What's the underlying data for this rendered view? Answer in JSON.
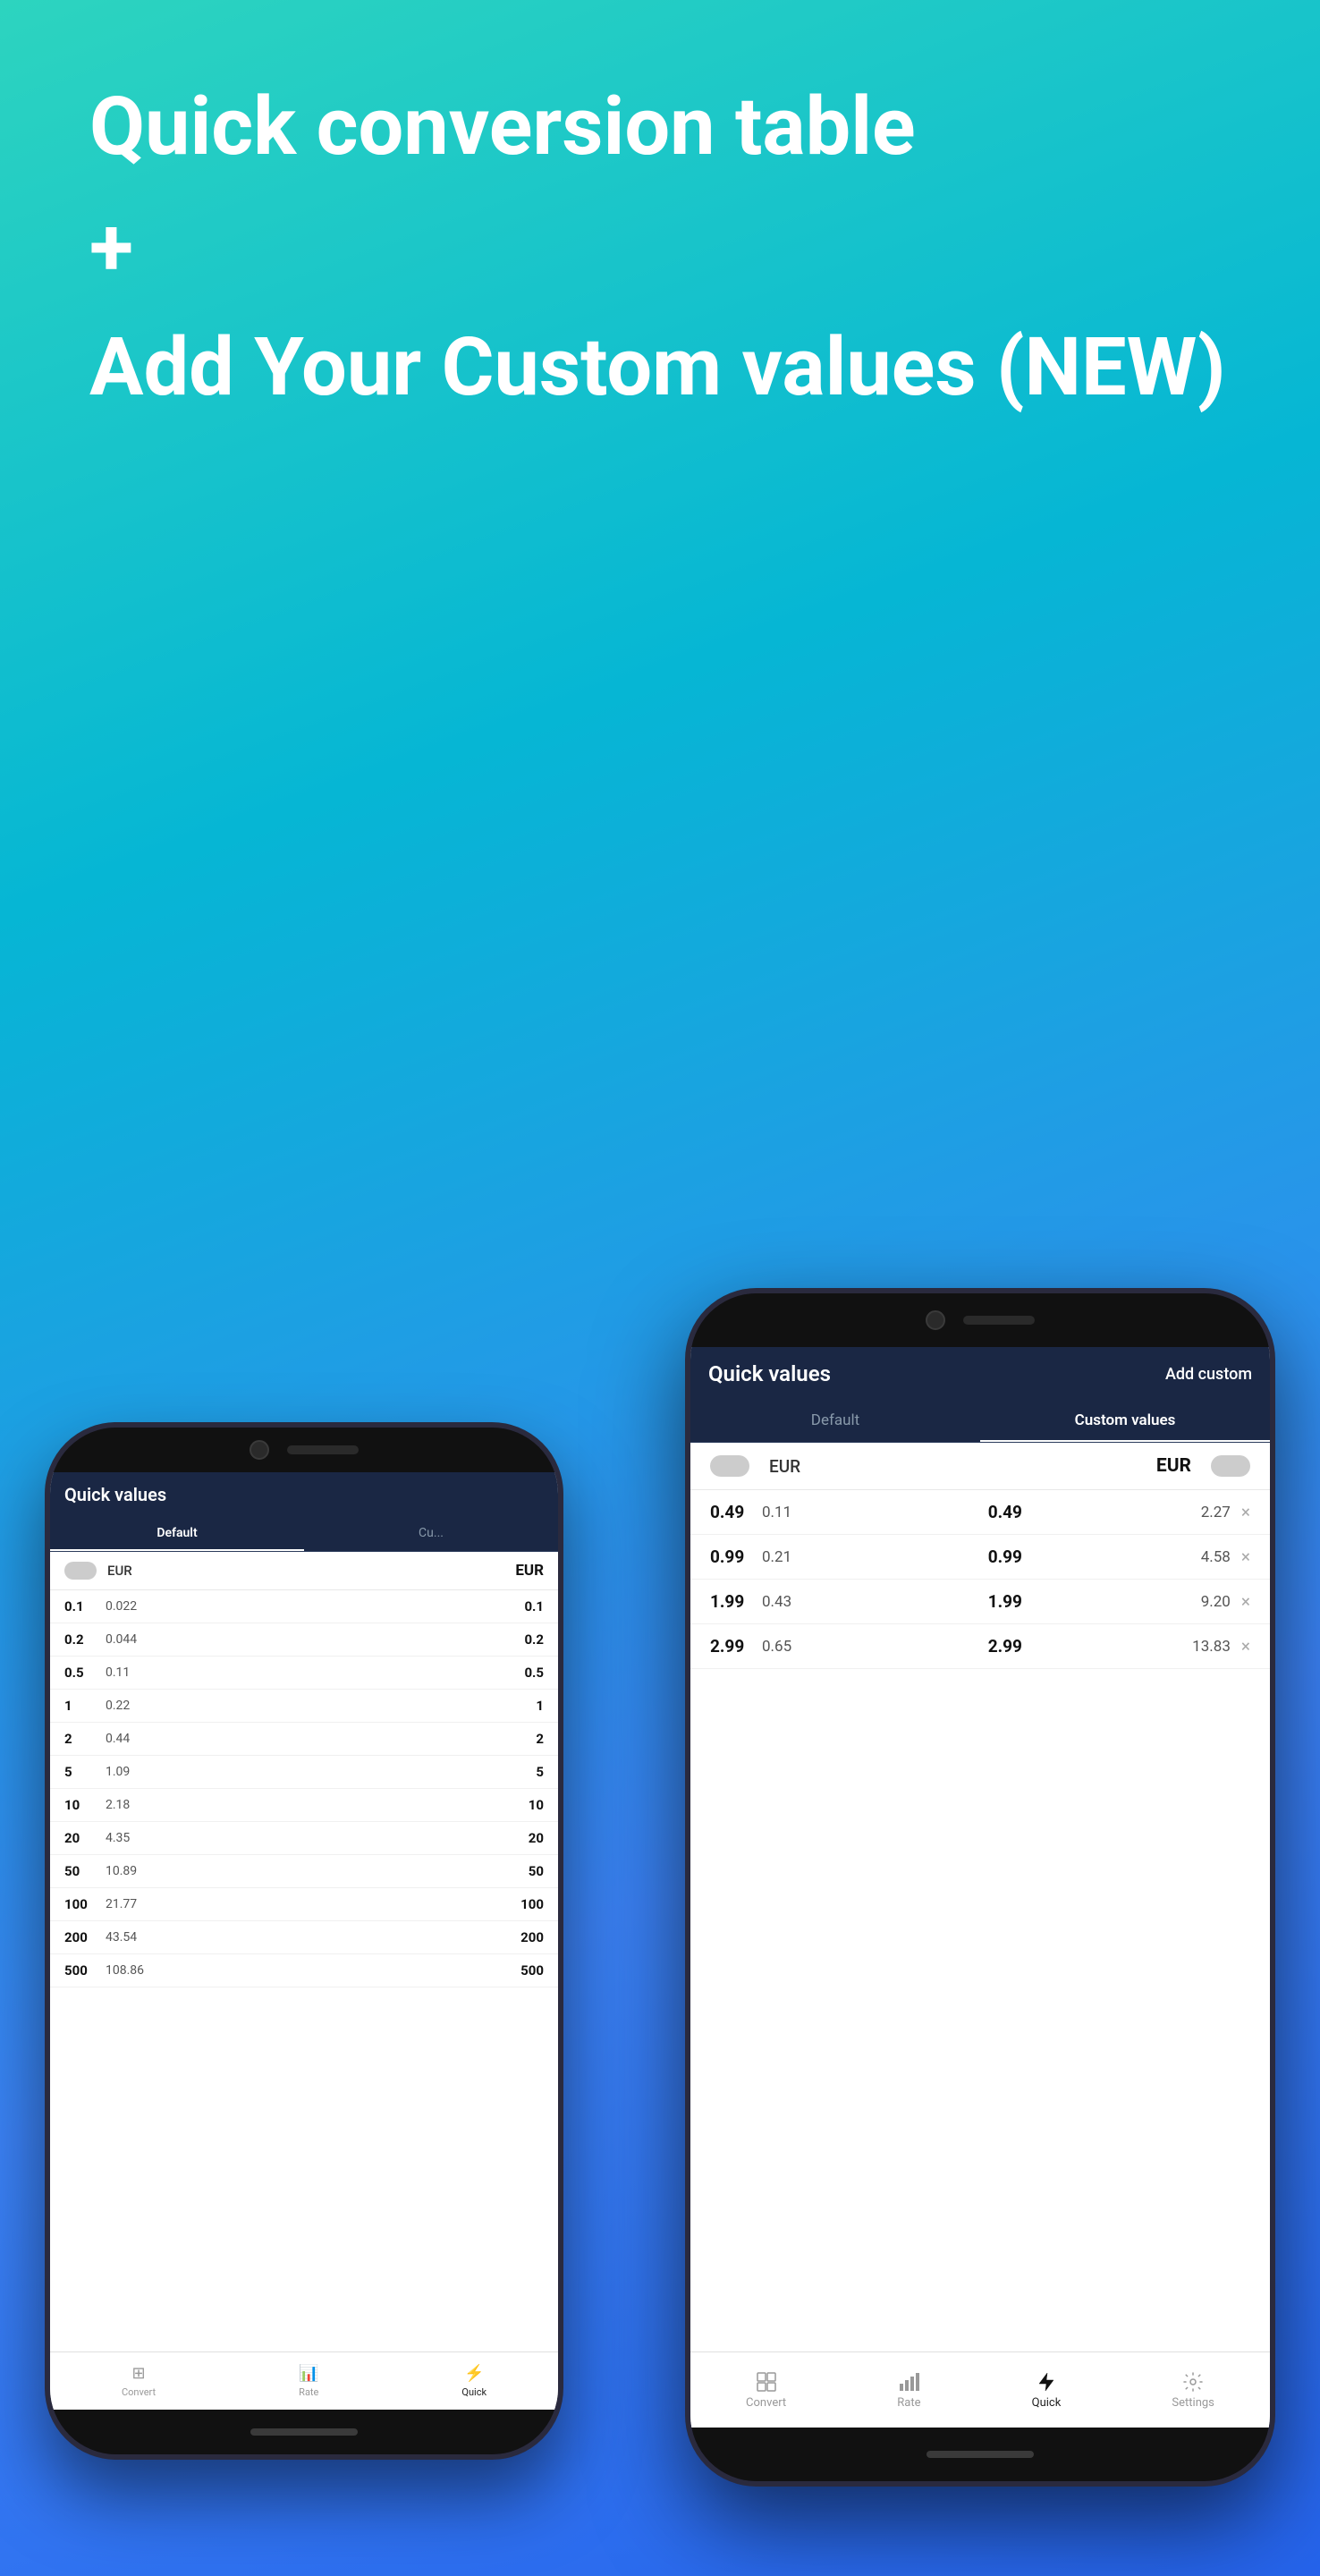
{
  "hero": {
    "title": "Quick conversion table",
    "plus": "+",
    "subtitle": "Add Your Custom values (NEW)"
  },
  "phone_back": {
    "title": "Quick values",
    "tabs": [
      "Default",
      "Cu..."
    ],
    "currency_from": "EUR",
    "currency_to": "EUR",
    "rows": [
      {
        "left_bold": "0.1",
        "left_val": "0.022",
        "right_bold": "0.1",
        "right_val": ""
      },
      {
        "left_bold": "0.2",
        "left_val": "0.044",
        "right_bold": "0.2",
        "right_val": ""
      },
      {
        "left_bold": "0.5",
        "left_val": "0.11",
        "right_bold": "0.5",
        "right_val": ""
      },
      {
        "left_bold": "1",
        "left_val": "0.22",
        "right_bold": "1",
        "right_val": ""
      },
      {
        "left_bold": "2",
        "left_val": "0.44",
        "right_bold": "2",
        "right_val": ""
      },
      {
        "left_bold": "5",
        "left_val": "1.09",
        "right_bold": "5",
        "right_val": ""
      },
      {
        "left_bold": "10",
        "left_val": "2.18",
        "right_bold": "10",
        "right_val": ""
      },
      {
        "left_bold": "20",
        "left_val": "4.35",
        "right_bold": "20",
        "right_val": ""
      },
      {
        "left_bold": "50",
        "left_val": "10.89",
        "right_bold": "50",
        "right_val": ""
      },
      {
        "left_bold": "100",
        "left_val": "21.77",
        "right_bold": "100",
        "right_val": ""
      },
      {
        "left_bold": "200",
        "left_val": "43.54",
        "right_bold": "200",
        "right_val": ""
      },
      {
        "left_bold": "500",
        "left_val": "108.86",
        "right_bold": "500",
        "right_val": ""
      }
    ],
    "nav": [
      {
        "label": "Convert",
        "active": false
      },
      {
        "label": "Rate",
        "active": false
      },
      {
        "label": "Quick",
        "active": true
      }
    ]
  },
  "phone_front": {
    "title": "Quick values",
    "add_custom": "Add custom",
    "tab_default": "Default",
    "tab_custom": "Custom values",
    "currency_from": "EUR",
    "currency_to": "EUR",
    "default_rows": [
      {
        "left_bold": "0.49",
        "left_val": "0.11"
      },
      {
        "left_bold": "0.99",
        "left_val": "0.21"
      },
      {
        "left_bold": "1.99",
        "left_val": "0.43"
      },
      {
        "left_bold": "2.99",
        "left_val": "0.65"
      }
    ],
    "custom_rows": [
      {
        "left_bold": "0.49",
        "left_val": "2.27"
      },
      {
        "left_bold": "0.99",
        "left_val": "4.58"
      },
      {
        "left_bold": "1.99",
        "left_val": "9.20"
      },
      {
        "left_bold": "2.99",
        "left_val": "13.83"
      }
    ],
    "nav": [
      {
        "label": "Convert",
        "active": false
      },
      {
        "label": "Rate",
        "active": false
      },
      {
        "label": "Quick",
        "active": true
      },
      {
        "label": "Settings",
        "active": false
      }
    ]
  }
}
